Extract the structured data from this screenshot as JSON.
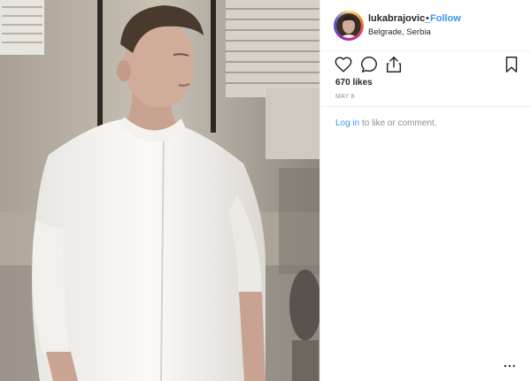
{
  "post": {
    "username": "lukabrajovic_",
    "separator": "•",
    "follow_label": "Follow",
    "location": "Belgrade, Serbia",
    "likes": "670 likes",
    "date": "MAY 8",
    "login_link": "Log in",
    "login_rest": " to like or comment.",
    "more_label": "..."
  },
  "icons": {
    "like": "heart-icon",
    "comment": "comment-icon",
    "share": "share-icon",
    "save": "bookmark-icon",
    "more": "more-icon"
  },
  "colors": {
    "link": "#3897f0",
    "text": "#262626",
    "muted": "#8e8e8e",
    "border": "#efefef"
  }
}
